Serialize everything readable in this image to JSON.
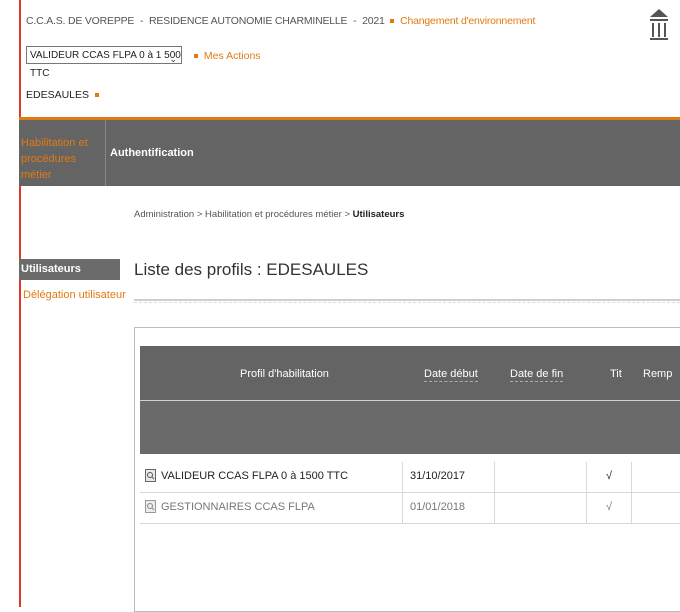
{
  "header": {
    "org": "C.C.A.S. DE VOREPPE",
    "separator": "-",
    "residence": "RESIDENCE AUTONOMIE CHARMINELLE",
    "year": "2021",
    "change_env": "Changement d'environnement",
    "profile_selected": "VALIDEUR CCAS FLPA 0 à 1 500 TTC",
    "mes_actions": "Mes Actions",
    "user": "EDESAULES"
  },
  "nav": {
    "tab_habilitation": "Habilitation et procédures métier",
    "tab_auth": "Authentification"
  },
  "breadcrumb": {
    "part1": "Administration",
    "part2": "Habilitation et procédures métier",
    "current": "Utilisateurs",
    "sep": ">"
  },
  "sidebar": {
    "active": "Utilisateurs",
    "link": "Délégation utilisateur"
  },
  "page": {
    "title": "Liste des profils : EDESAULES"
  },
  "table": {
    "headers": {
      "profil": "Profil d'habilitation",
      "date_debut": "Date début",
      "date_fin": "Date de fin",
      "tit": "Tit",
      "remp": "Remp"
    },
    "rows": [
      {
        "profil": "VALIDEUR CCAS FLPA 0 à 1500 TTC",
        "date_debut": "31/10/2017",
        "date_fin": "",
        "tit": "√",
        "remp": ""
      },
      {
        "profil": "GESTIONNAIRES CCAS FLPA",
        "date_debut": "01/01/2018",
        "date_fin": "",
        "tit": "√",
        "remp": ""
      }
    ]
  },
  "colors": {
    "accent": "#e07b13",
    "nav_bg": "#646464",
    "left_rule": "#e0362b"
  },
  "icons": {
    "profile_dropdown": "chevron-down-icon",
    "institution": "bank-icon",
    "row_view": "document-icon"
  }
}
